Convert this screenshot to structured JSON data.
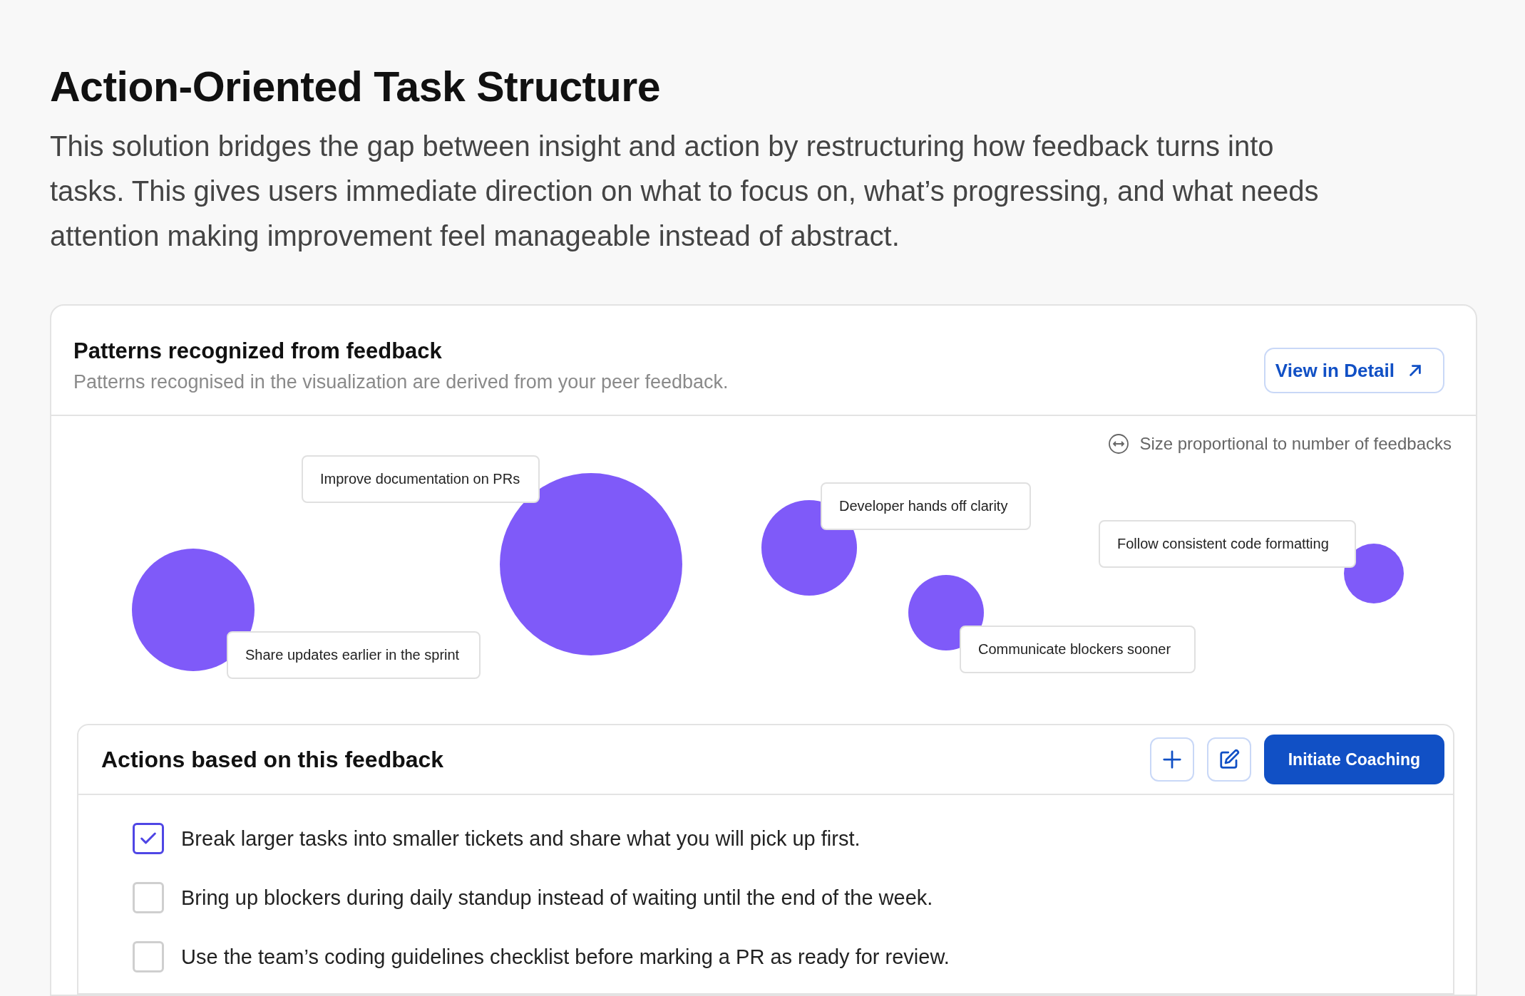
{
  "title": "Action-Oriented Task Structure",
  "description": "This solution bridges the gap between insight and action by restructuring how feedback turns into tasks.  This gives users immediate direction on what to focus on, what’s progressing, and what needs attention making improvement feel manageable instead of abstract.",
  "patterns_card": {
    "title": "Patterns recognized from feedback",
    "subtitle": "Patterns recognised  in the visualization are derived from your peer feedback.",
    "detail_button": "View in Detail",
    "legend": "Size proportional to number of feedbacks",
    "bubbles": [
      {
        "label": "Share updates earlier in the sprint"
      },
      {
        "label": "Improve documentation on PRs"
      },
      {
        "label": "Developer hands off clarity"
      },
      {
        "label": "Communicate blockers sooner"
      },
      {
        "label": "Follow consistent code formatting"
      }
    ]
  },
  "actions_card": {
    "title": "Actions based on this feedback",
    "primary_button": "Initiate Coaching",
    "items": [
      {
        "text": "Break larger tasks into smaller tickets and share what you will pick up first.",
        "checked": true
      },
      {
        "text": "Bring up blockers during daily standup instead of waiting until the end of the week.",
        "checked": false
      },
      {
        "text": "Use the team’s coding guidelines checklist before marking a PR as ready for review.",
        "checked": false
      }
    ]
  }
}
